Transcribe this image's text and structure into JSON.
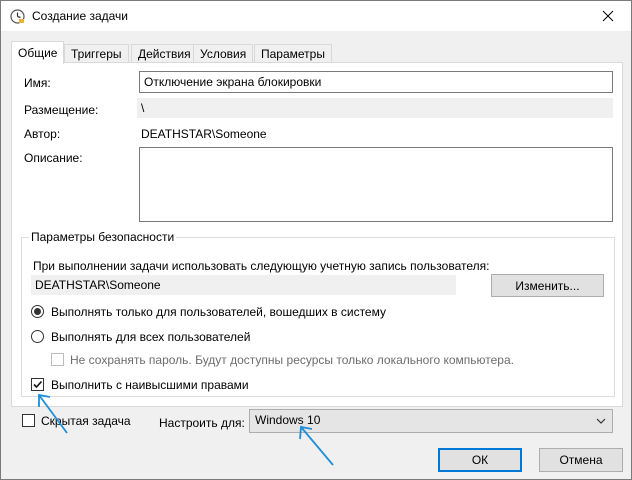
{
  "window": {
    "title": "Создание задачи",
    "colors": {
      "accent": "#0078d7",
      "arrow": "#1e8fd8"
    },
    "icons": {
      "title": "task-scheduler-icon",
      "close": "close-icon"
    }
  },
  "tabs": [
    {
      "label": "Общие",
      "active": true
    },
    {
      "label": "Триггеры"
    },
    {
      "label": "Действия"
    },
    {
      "label": "Условия"
    },
    {
      "label": "Параметры"
    }
  ],
  "general": {
    "name_label": "Имя:",
    "name_value": "Отключение экрана блокировки",
    "location_label": "Размещение:",
    "location_value": "\\",
    "author_label": "Автор:",
    "author_value": "DEATHSTAR\\Someone",
    "description_label": "Описание:",
    "description_value": ""
  },
  "security": {
    "title": "Параметры безопасности",
    "account_prompt": "При выполнении задачи использовать следующую учетную запись пользователя:",
    "account_value": "DEATHSTAR\\Someone",
    "change_button": "Изменить...",
    "radio_logged_on": "Выполнять только для пользователей, вошедших в систему",
    "radio_all_users": "Выполнять для всех пользователей",
    "no_store_password": "Не сохранять пароль. Будут доступны ресурсы только локального компьютера.",
    "highest_privileges": "Выполнить с наивысшими правами"
  },
  "footer": {
    "hidden_task": "Скрытая задача",
    "configure_for_label": "Настроить для:",
    "configure_for_value": "Windows 10",
    "ok_button": "ОК",
    "cancel_button": "Отмена"
  }
}
